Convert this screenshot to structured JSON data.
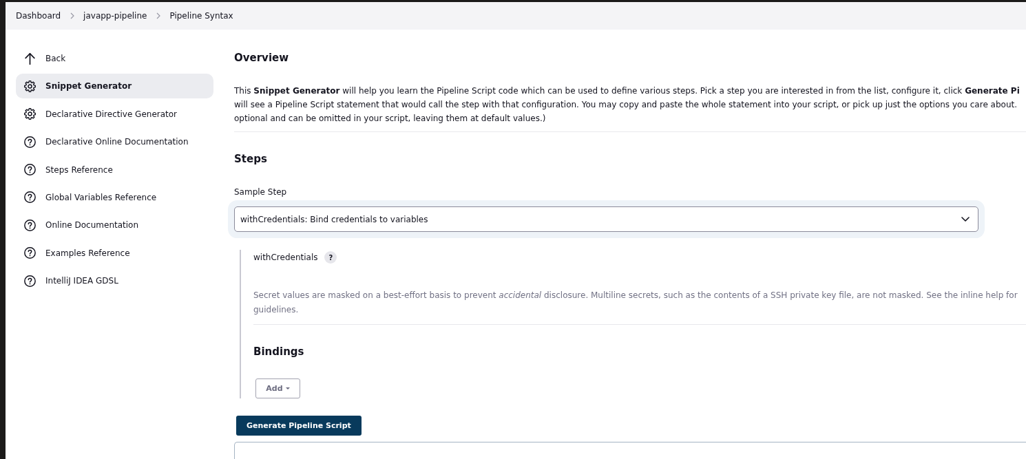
{
  "breadcrumbs": [
    {
      "label": "Dashboard"
    },
    {
      "label": "javapp-pipeline"
    },
    {
      "label": "Pipeline Syntax"
    }
  ],
  "sidebar": {
    "items": [
      {
        "label": "Back",
        "kind": "back",
        "selected": false
      },
      {
        "label": "Snippet Generator",
        "kind": "gear",
        "selected": true
      },
      {
        "label": "Declarative Directive Generator",
        "kind": "gear",
        "selected": false
      },
      {
        "label": "Declarative Online Documentation",
        "kind": "help",
        "selected": false
      },
      {
        "label": "Steps Reference",
        "kind": "help",
        "selected": false
      },
      {
        "label": "Global Variables Reference",
        "kind": "help",
        "selected": false
      },
      {
        "label": "Online Documentation",
        "kind": "help",
        "selected": false
      },
      {
        "label": "Examples Reference",
        "kind": "help",
        "selected": false
      },
      {
        "label": "IntelliJ IDEA GDSL",
        "kind": "help",
        "selected": false
      }
    ]
  },
  "overview": {
    "title": "Overview",
    "lines": [
      "This **Snippet Generator** will help you learn the Pipeline Script code which can be used to define various steps. Pick a step you are interested in from the list, configure it, click **Generate Pi**",
      "will see a Pipeline Script statement that would call the step with that configuration. You may copy and paste the whole statement into your script, or pick up just the options you care about.",
      "optional and can be omitted in your script, leaving them at default values.)"
    ]
  },
  "steps": {
    "title": "Steps",
    "sample_step": {
      "label": "Sample Step",
      "value": "withCredentials: Bind credentials to variables"
    },
    "step_config": {
      "name": "withCredentials",
      "help": "?",
      "description_lines": [
        "Secret values are masked on a best-effort basis to prevent *accidental* disclosure. Multiline secrets, such as the contents of a SSH private key file, are not masked. See the inline help for",
        "guidelines."
      ],
      "bindings_title": "Bindings",
      "add_button": "Add"
    }
  },
  "generate_button": "Generate Pipeline Script"
}
